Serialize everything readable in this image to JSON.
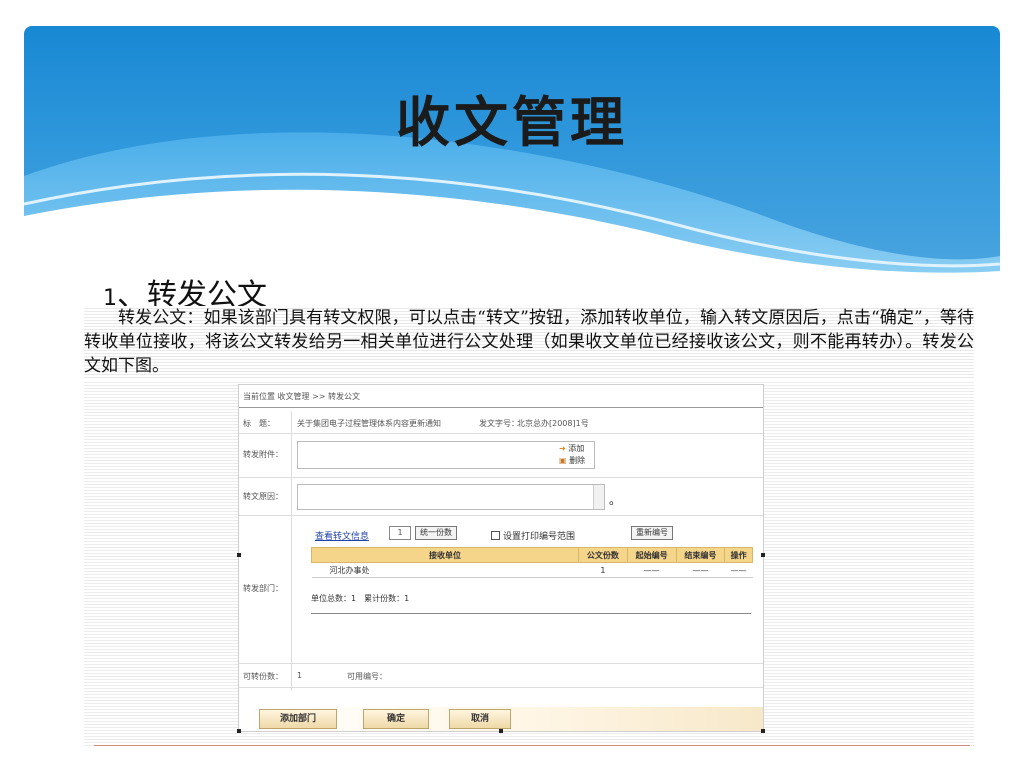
{
  "slide": {
    "title": "收文管理",
    "heading_num": "1",
    "heading_text": "、转发公文",
    "paragraph": "转发公文：如果该部门具有转文权限，可以点击“转文”按钮，添加转收单位，输入转文原因后，点击“确定”，等待转收单位接收，将该公文转发给另一相关单位进行公文处理（如果收文单位已经接收该公文，则不能再转办）。转发公文如下图。"
  },
  "form": {
    "breadcrumb": "当前位置 收文管理 >> 转发公文",
    "subject_label": "标　题：",
    "subject_value": "关于集团电子过程管理体系内容更新通知",
    "doc_no_label": "发文字号：",
    "doc_no_value": "北京总办[2008]1号",
    "attachment_label": "转发附件：",
    "add_label": "添加",
    "delete_label": "删除",
    "reason_label": "转文原因：",
    "reason_suffix": "。",
    "dept_label": "转发部门：",
    "view_info": "查看转文信息",
    "copies_value": "1",
    "unify_copies": "统一份数",
    "print_range": "设置打印编号范围",
    "renumber": "重新编号",
    "table_headers": [
      "接收单位",
      "公文份数",
      "起始编号",
      "结束编号",
      "操作"
    ],
    "table_rows": [
      [
        "河北办事处",
        "1",
        "——",
        "——",
        "——"
      ]
    ],
    "summary": "单位总数：1　累计份数：1",
    "transferable_label": "可转份数：",
    "transferable_value": "1",
    "available_no_label": "可用编号：",
    "add_dept_button": "添加部门",
    "confirm_button": "确定",
    "cancel_button": "取消"
  }
}
